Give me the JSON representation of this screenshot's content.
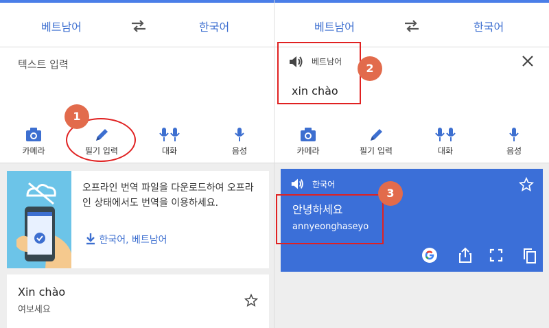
{
  "left": {
    "source_lang": "베트남어",
    "target_lang": "한국어",
    "input_placeholder": "텍스트 입력",
    "tools": [
      {
        "label": "카메라"
      },
      {
        "label": "필기 입력"
      },
      {
        "label": "대화"
      },
      {
        "label": "음성"
      }
    ],
    "offline_card": {
      "text": "오프라인 번역 파일을 다운로드하여 오프라인 상태에서도 번역을 이용하세요.",
      "download_link": "한국어, 베트남어"
    },
    "phrase_card": {
      "source": "Xin chào",
      "translation": "여보세요"
    }
  },
  "right": {
    "source_lang": "베트남어",
    "target_lang": "한국어",
    "input": {
      "lang_label": "베트남어",
      "text": "xin chào"
    },
    "tools": [
      {
        "label": "카메라"
      },
      {
        "label": "필기 입력"
      },
      {
        "label": "대화"
      },
      {
        "label": "음성"
      }
    ],
    "result": {
      "lang_label": "한국어",
      "text": "안녕하세요",
      "romanization": "annyeonghaseyo"
    }
  },
  "annotations": {
    "badge_1": "1",
    "badge_2": "2",
    "badge_3": "3"
  },
  "colors": {
    "accent": "#3d6fd0",
    "result_bg": "#3b6fd8",
    "annotation_red": "#e02121",
    "badge": "#e26b4c"
  }
}
